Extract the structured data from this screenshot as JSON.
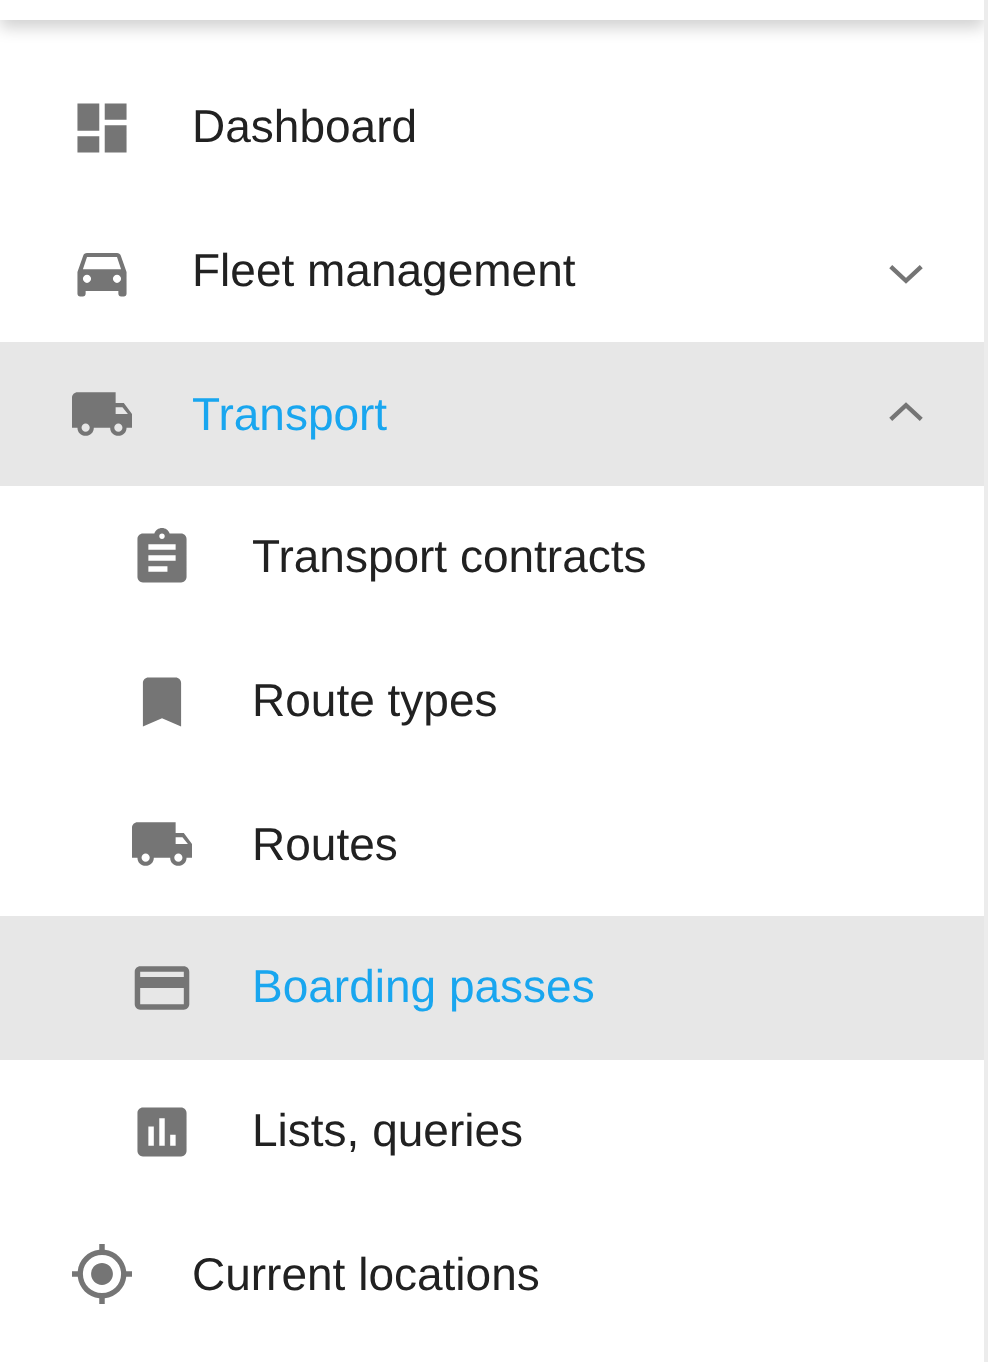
{
  "sidebar": {
    "items": [
      {
        "label": "Dashboard",
        "selected": false
      },
      {
        "label": "Fleet management",
        "selected": false,
        "expanded": false
      },
      {
        "label": "Transport",
        "selected": true,
        "expanded": true,
        "children": [
          {
            "label": "Transport contracts",
            "selected": false
          },
          {
            "label": "Route types",
            "selected": false
          },
          {
            "label": "Routes",
            "selected": false
          },
          {
            "label": "Boarding passes",
            "selected": true
          },
          {
            "label": "Lists, queries",
            "selected": false
          }
        ]
      },
      {
        "label": "Current locations",
        "selected": false
      }
    ]
  }
}
